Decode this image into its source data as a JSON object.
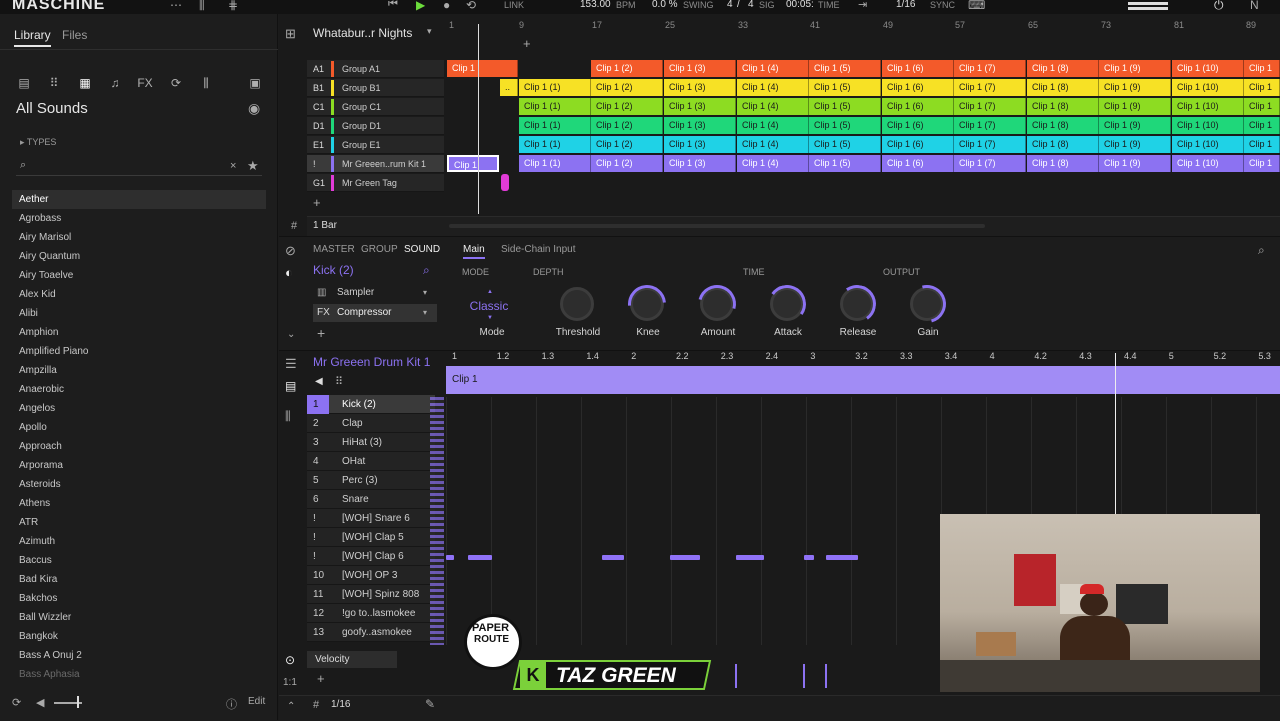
{
  "topbar": {
    "app_title": "MASCHINE",
    "link": "LINK",
    "bpm_value": "153.00",
    "bpm_label": "BPM",
    "swing_value": "0.0 %",
    "swing_label": "SWING",
    "sig_num": "4",
    "sig_sep": "/",
    "sig_den": "4",
    "sig_label": "SIG",
    "time_value": "00:05:",
    "time_label": "TIME",
    "grid_value": "1/16",
    "sync_label": "SYNC"
  },
  "library": {
    "tabs": [
      "Library",
      "Files"
    ],
    "heading": "All Sounds",
    "types_label": "TYPES",
    "sounds": [
      "Aether",
      "Agrobass",
      "Airy Marisol",
      "Airy Quantum",
      "Airy Toaelve",
      "Alex Kid",
      "Alibi",
      "Amphion",
      "Amplified Piano",
      "Ampzilla",
      "Anaerobic",
      "Angelos",
      "Apollo",
      "Approach",
      "Arporama",
      "Asteroids",
      "Athens",
      "ATR",
      "Azimuth",
      "Baccus",
      "Bad Kira",
      "Bakchos",
      "Ball Wizzler",
      "Bangkok",
      "Bass A Onuj 2",
      "Bass Aphasia"
    ],
    "selected_index": 0,
    "edit_label": "Edit"
  },
  "arranger": {
    "song_name": "Whatabur..r Nights",
    "ruler": [
      "1",
      "9",
      "17",
      "25",
      "33",
      "41",
      "49",
      "57",
      "65",
      "73",
      "81",
      "89"
    ],
    "groups": [
      {
        "id": "A1",
        "name": "Group A1",
        "color": "#f35a2a"
      },
      {
        "id": "B1",
        "name": "Group B1",
        "color": "#f7e125"
      },
      {
        "id": "C1",
        "name": "Group C1",
        "color": "#8ddc22"
      },
      {
        "id": "D1",
        "name": "Group D1",
        "color": "#1fd77a"
      },
      {
        "id": "E1",
        "name": "Group E1",
        "color": "#1fd2e6"
      },
      {
        "id": "!",
        "name": "Mr Greeen..rum Kit 1",
        "color": "#8c72f2"
      },
      {
        "id": "G1",
        "name": "Mr Green Tag",
        "color": "#e23bd8"
      }
    ],
    "clip_labels": [
      "Clip 1",
      "Clip 1 (1)",
      "Clip 1 (2)",
      "Clip 1 (3)",
      "Clip 1 (4)",
      "Clip 1 (5)",
      "Clip 1 (6)",
      "Clip 1 (7)",
      "Clip 1 (8)",
      "Clip 1 (9)",
      "Clip 1 (10)",
      "Clip 1"
    ],
    "ellipsis": "..",
    "bar_length": "1 Bar"
  },
  "device": {
    "tabs": [
      "MASTER",
      "GROUP",
      "SOUND"
    ],
    "sound_name": "Kick (2)",
    "plugins": [
      "Sampler",
      "Compressor"
    ],
    "subtabs": [
      "Main",
      "Side-Chain Input"
    ],
    "sections": [
      "MODE",
      "DEPTH",
      "TIME",
      "OUTPUT"
    ],
    "mode_value": "Classic",
    "knobs": [
      "Mode",
      "Threshold",
      "Knee",
      "Amount",
      "Attack",
      "Release",
      "Gain"
    ]
  },
  "pattern": {
    "kit_name": "Mr Greeen Drum Kit 1",
    "ruler": [
      "1",
      "1.2",
      "1.3",
      "1.4",
      "2",
      "2.2",
      "2.3",
      "2.4",
      "3",
      "3.2",
      "3.3",
      "3.4",
      "4",
      "4.2",
      "4.3",
      "4.4",
      "5",
      "5.2",
      "5.3"
    ],
    "clip_label": "Clip 1",
    "pads": [
      {
        "n": "1",
        "name": "Kick (2)"
      },
      {
        "n": "2",
        "name": "Clap"
      },
      {
        "n": "3",
        "name": "HiHat (3)"
      },
      {
        "n": "4",
        "name": "OHat"
      },
      {
        "n": "5",
        "name": "Perc (3)"
      },
      {
        "n": "6",
        "name": "Snare"
      },
      {
        "n": "!",
        "name": "[WOH] Snare 6"
      },
      {
        "n": "!",
        "name": "[WOH] Clap 5"
      },
      {
        "n": "!",
        "name": "[WOH] Clap 6"
      },
      {
        "n": "10",
        "name": "[WOH] OP 3"
      },
      {
        "n": "11",
        "name": "[WOH] Spinz 808"
      },
      {
        "n": "12",
        "name": "!go to..lasmokee"
      },
      {
        "n": "13",
        "name": "goofy..asmokee"
      }
    ],
    "velocity_label": "Velocity",
    "grid_value": "1/16"
  },
  "overlay": {
    "logo_top": "PAPER",
    "logo_bottom": "ROUTE",
    "brand": "TAZ GREEN"
  }
}
